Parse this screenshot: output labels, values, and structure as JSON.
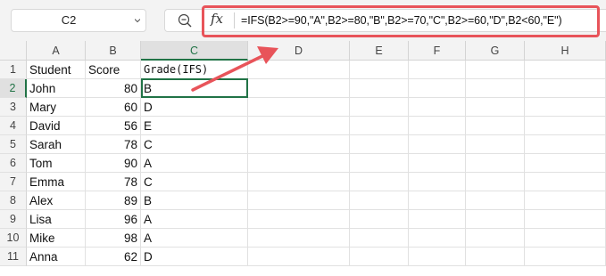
{
  "name_box": {
    "value": "C2"
  },
  "formula_bar": {
    "fx_label": "fx",
    "formula": "=IFS(B2>=90,\"A\",B2>=80,\"B\",B2>=70,\"C\",B2>=60,\"D\",B2<60,\"E\")"
  },
  "columns": [
    "A",
    "B",
    "C",
    "D",
    "E",
    "F",
    "G",
    "H"
  ],
  "rows": [
    {
      "num": "1",
      "a": "Student",
      "b": "Score",
      "c": "Grade(IFS)"
    },
    {
      "num": "2",
      "a": "John",
      "b": "80",
      "c": "B"
    },
    {
      "num": "3",
      "a": "Mary",
      "b": "60",
      "c": "D"
    },
    {
      "num": "4",
      "a": "David",
      "b": "56",
      "c": "E"
    },
    {
      "num": "5",
      "a": "Sarah",
      "b": "78",
      "c": "C"
    },
    {
      "num": "6",
      "a": "Tom",
      "b": "90",
      "c": "A"
    },
    {
      "num": "7",
      "a": "Emma",
      "b": "78",
      "c": "C"
    },
    {
      "num": "8",
      "a": "Alex",
      "b": "89",
      "c": "B"
    },
    {
      "num": "9",
      "a": "Lisa",
      "b": "96",
      "c": "A"
    },
    {
      "num": "10",
      "a": "Mike",
      "b": "98",
      "c": "A"
    },
    {
      "num": "11",
      "a": "Anna",
      "b": "62",
      "c": "D"
    }
  ],
  "selected_cell": "C2",
  "colors": {
    "selection": "#217346",
    "annotation": "#e8545a"
  },
  "icons": {
    "zoom": "zoom-icon",
    "caret": "chevron-down-icon",
    "fx": "function-icon"
  }
}
